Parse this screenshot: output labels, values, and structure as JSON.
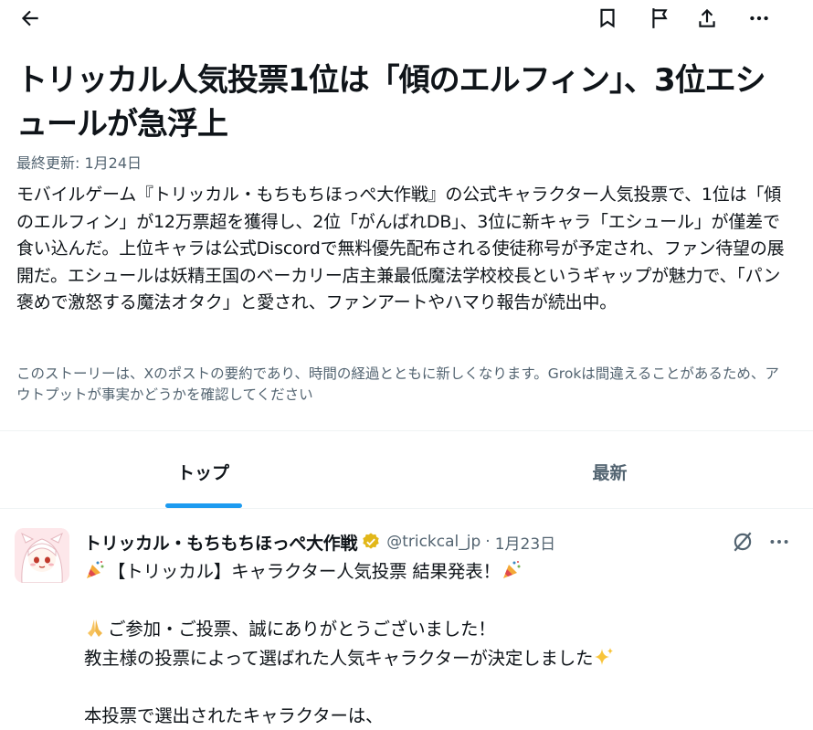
{
  "header": {
    "back_icon": "arrow-left-icon",
    "actions": [
      "bookmark-icon",
      "flag-icon",
      "share-icon",
      "more-icon"
    ]
  },
  "story": {
    "title": "トリッカル人気投票1位は「傾のエルフィン」、3位エシュールが急浮上",
    "updated": "最終更新: 1月24日",
    "summary": "モバイルゲーム『トリッカル・もちもちほっぺ大作戦』の公式キャラクター人気投票で、1位は「傾のエルフィン」が12万票超を獲得し、2位「がんばれDB」、3位に新キャラ「エシュール」が僅差で食い込んだ。上位キャラは公式Discordで無料優先配布される使徒称号が予定され、ファン待望の展開だ。エシュールは妖精王国のベーカリー店主兼最低魔法学校校長というギャップが魅力で、「パン褒めで激怒する魔法オタク」と愛され、ファンアートやハマり報告が続出中。",
    "disclaimer": "このストーリーは、Xのポストの要約であり、時間の経過とともに新しくなります。Grokは間違えることがあるため、アウトプットが事実かどうかを確認してください"
  },
  "tabs": [
    {
      "label": "トップ",
      "active": true
    },
    {
      "label": "最新",
      "active": false
    }
  ],
  "post": {
    "author": "トリッカル・もちもちほっぺ大作戦",
    "handle": "@trickcal_jp",
    "separator": "·",
    "date": "1月23日",
    "lines": [
      "【トリッカル】キャラクター人気投票 結果発表！",
      "",
      "ご参加・ご投票、誠にありがとうございました！",
      "教主様の投票によって選ばれた人気キャラクターが決定しました",
      "",
      "本投票で選出されたキャラクターは、"
    ]
  },
  "colors": {
    "text": "#0f1419",
    "secondary": "#536471",
    "accent": "#1d9bf0",
    "divider": "#eff3f4",
    "verified": "#e2b719"
  }
}
